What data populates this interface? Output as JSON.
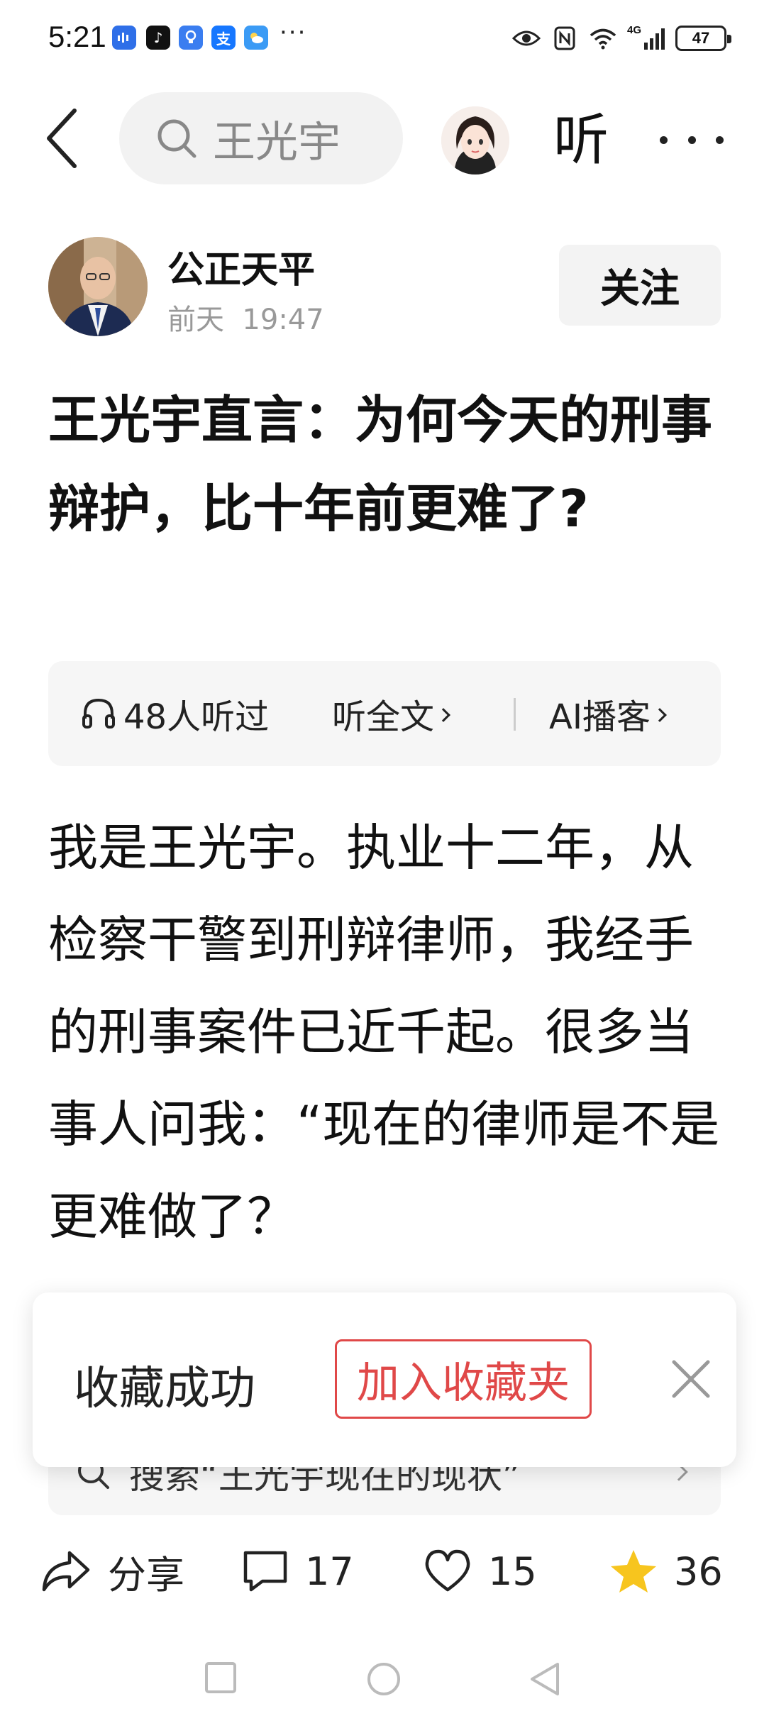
{
  "status_bar": {
    "time": "5:21",
    "network": "4G",
    "battery": "47",
    "more_dots": "···"
  },
  "nav": {
    "search_text": "王光宇",
    "listen_label": "听"
  },
  "author": {
    "name": "公正天平",
    "time": "前天  19:47",
    "follow_label": "关注"
  },
  "article": {
    "title": "王光宇直言：为何今天的刑事辩护，比十年前更难了?",
    "body": "我是王光宇。执业十二年，从检察干警到刑辩律师，我经手的刑事案件已近千起。很多当事人问我：“现在的律师是不是更难做了？"
  },
  "listen_bar": {
    "count_label": "48人听过",
    "full_text_label": "听全文",
    "ai_podcast_label": "AI播客"
  },
  "related_search": {
    "text": "搜索“王光宇现在的现状”"
  },
  "toast": {
    "message": "收藏成功",
    "add_folder_label": "加入收藏夹"
  },
  "actions": {
    "share_label": "分享",
    "comment_count": "17",
    "like_count": "15",
    "favorite_count": "36"
  },
  "colors": {
    "accent_red": "#e04848",
    "star_yellow": "#f7c51e"
  }
}
